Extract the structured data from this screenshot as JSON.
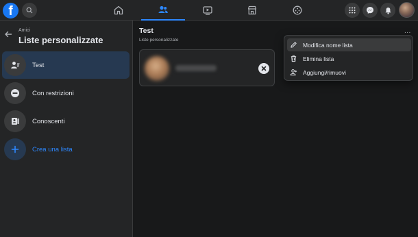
{
  "sidebar": {
    "breadcrumb": "Amici",
    "title": "Liste personalizzate",
    "items": [
      {
        "label": "Test"
      },
      {
        "label": "Con restrizioni"
      },
      {
        "label": "Conoscenti"
      },
      {
        "label": "Crea una lista"
      }
    ]
  },
  "main": {
    "list_title": "Test",
    "list_subtitle": "Liste personalizzate",
    "more_label": "..."
  },
  "dropdown": {
    "items": [
      {
        "label": "Modifica nome lista",
        "icon": "pencil-icon"
      },
      {
        "label": "Elimina lista",
        "icon": "trash-icon"
      },
      {
        "label": "Aggiungi/rimuovi",
        "icon": "person-add-icon"
      }
    ]
  },
  "colors": {
    "accent": "#2d88ff",
    "brand": "#1877f2",
    "background": "#18191a",
    "surface": "#242526",
    "active_item": "#263951"
  }
}
